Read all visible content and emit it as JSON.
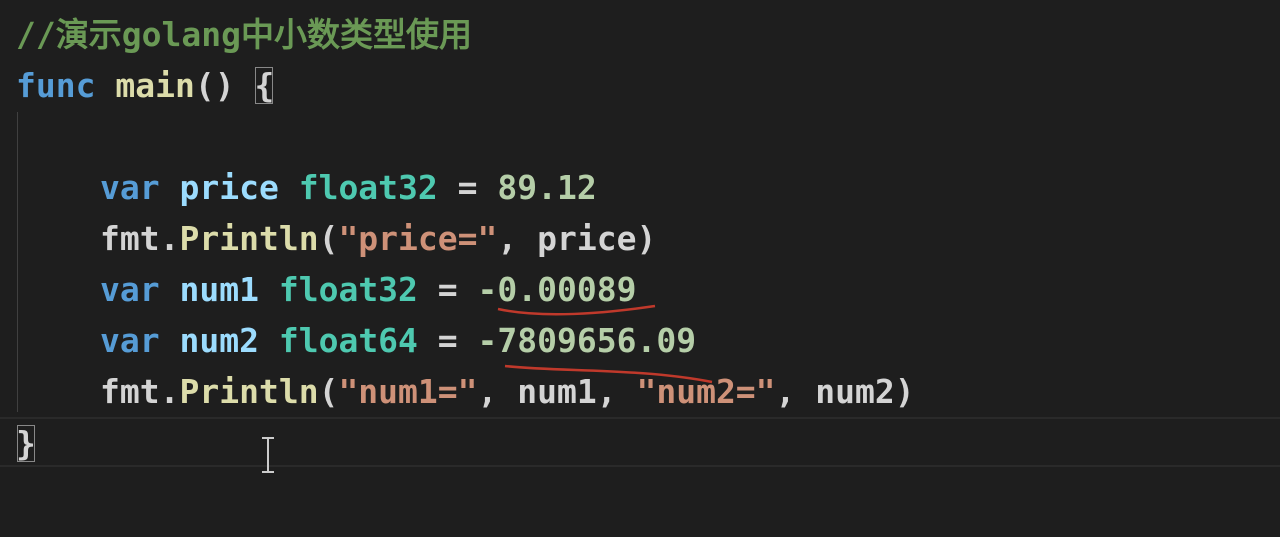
{
  "code": {
    "comment": "//演示golang中小数类型使用",
    "func_kw": "func",
    "func_name": "main",
    "func_paren": "() ",
    "open_brace": "{",
    "line_price": {
      "kw": "var",
      "name": "price",
      "type": "float32",
      "eq": " = ",
      "value": "89.12"
    },
    "line_println1": {
      "pkg": "fmt.",
      "fn": "Println",
      "open": "(",
      "str": "\"price=\"",
      "rest": ", price)"
    },
    "line_num1": {
      "kw": "var",
      "name": "num1",
      "type": "float32",
      "eq": " = ",
      "value": "-0.00089"
    },
    "line_num2": {
      "kw": "var",
      "name": "num2",
      "type": "float64",
      "eq": " = ",
      "value": "-7809656.09"
    },
    "line_println2": {
      "pkg": "fmt.",
      "fn": "Println",
      "open": "(",
      "str1": "\"num1=\"",
      "mid": ", num1, ",
      "str2": "\"num2=\"",
      "rest": ", num2)"
    },
    "close_brace": "}"
  },
  "colors": {
    "background": "#1e1e1e",
    "comment": "#6a9955",
    "keyword": "#569cd6",
    "function": "#dcdcaa",
    "variable": "#9cdcfe",
    "type": "#4ec9b0",
    "number": "#b5cea8",
    "string": "#ce9178",
    "annotation": "#c0392b"
  }
}
